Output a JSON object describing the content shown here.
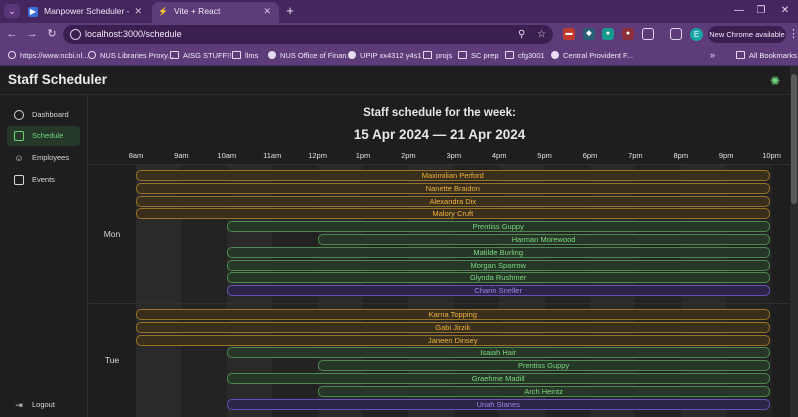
{
  "browser": {
    "tabs": [
      {
        "title": "Manpower Scheduler - Video",
        "active": false,
        "icon": "youtube-icon"
      },
      {
        "title": "Vite + React",
        "active": true,
        "icon": "vite-icon"
      }
    ],
    "new_tab": "+",
    "url": "localhost:3000/schedule",
    "update_button": "New Chrome available",
    "profile_initial": "E",
    "bookmarks": [
      {
        "label": "https://www.ncbi.nl...",
        "icon": "globe-icon"
      },
      {
        "label": "NUS Libraries Proxy...",
        "icon": "globe-icon"
      },
      {
        "label": "AISG STUFF!!",
        "icon": "folder-icon"
      },
      {
        "label": "llms",
        "icon": "folder-icon"
      },
      {
        "label": "NUS Office of Finan...",
        "icon": "nus-icon"
      },
      {
        "label": "UPIP xx4312 y4s1",
        "icon": "nus-icon"
      },
      {
        "label": "projs",
        "icon": "folder-icon"
      },
      {
        "label": "SC prep",
        "icon": "folder-icon"
      },
      {
        "label": "cfg3001",
        "icon": "folder-icon"
      },
      {
        "label": "Central Provident F...",
        "icon": "cpf-icon"
      }
    ],
    "all_bookmarks": "All Bookmarks"
  },
  "app": {
    "title": "Staff Scheduler",
    "theme_icon": "sun-icon"
  },
  "sidebar": {
    "items": [
      {
        "label": "Dashboard",
        "icon": "gauge-icon",
        "active": false
      },
      {
        "label": "Schedule",
        "icon": "calendar-icon",
        "active": true
      },
      {
        "label": "Employees",
        "icon": "users-icon",
        "active": false
      },
      {
        "label": "Events",
        "icon": "event-icon",
        "active": false
      }
    ],
    "logout": "Logout"
  },
  "schedule": {
    "heading": "Staff schedule for the week:",
    "range": "15 Apr 2024 — 21 Apr 2024",
    "hours": [
      "8am",
      "9am",
      "10am",
      "11am",
      "12pm",
      "1pm",
      "2pm",
      "3pm",
      "4pm",
      "5pm",
      "6pm",
      "7pm",
      "8pm",
      "9pm",
      "10pm"
    ],
    "colors": {
      "orange": "#f3b23c",
      "green": "#7dd87f",
      "purple": "#9b86f0"
    },
    "days": [
      {
        "day": "Mon",
        "shifts": [
          {
            "name": "Maximilian Perford",
            "start": 8,
            "end": 22,
            "color": "orange"
          },
          {
            "name": "Nanette Braidon",
            "start": 8,
            "end": 22,
            "color": "orange"
          },
          {
            "name": "Alexandra Dix",
            "start": 8,
            "end": 22,
            "color": "orange"
          },
          {
            "name": "Malory Cruft",
            "start": 8,
            "end": 22,
            "color": "orange"
          },
          {
            "name": "Prentiss Guppy",
            "start": 10,
            "end": 22,
            "color": "green"
          },
          {
            "name": "Harman Morewood",
            "start": 12,
            "end": 22,
            "color": "green"
          },
          {
            "name": "Matilde Burling",
            "start": 10,
            "end": 22,
            "color": "green"
          },
          {
            "name": "Morgan Sparrow",
            "start": 10,
            "end": 22,
            "color": "green"
          },
          {
            "name": "Glynda Rushmer",
            "start": 10,
            "end": 22,
            "color": "green"
          },
          {
            "name": "Charin Sneller",
            "start": 10,
            "end": 22,
            "color": "purple"
          }
        ]
      },
      {
        "day": "Tue",
        "shifts": [
          {
            "name": "Karna Topping",
            "start": 8,
            "end": 22,
            "color": "orange"
          },
          {
            "name": "Gabi Jirzik",
            "start": 8,
            "end": 22,
            "color": "orange"
          },
          {
            "name": "Janeen Dinsey",
            "start": 8,
            "end": 22,
            "color": "orange"
          },
          {
            "name": "Isaiah Hair",
            "start": 10,
            "end": 22,
            "color": "green"
          },
          {
            "name": "Prentiss Guppy",
            "start": 12,
            "end": 22,
            "color": "green"
          },
          {
            "name": "Graehme Madill",
            "start": 10,
            "end": 22,
            "color": "green"
          },
          {
            "name": "Arch Heintz",
            "start": 12,
            "end": 22,
            "color": "green"
          },
          {
            "name": "Uriah Stanes",
            "start": 10,
            "end": 22,
            "color": "purple"
          }
        ]
      }
    ]
  }
}
